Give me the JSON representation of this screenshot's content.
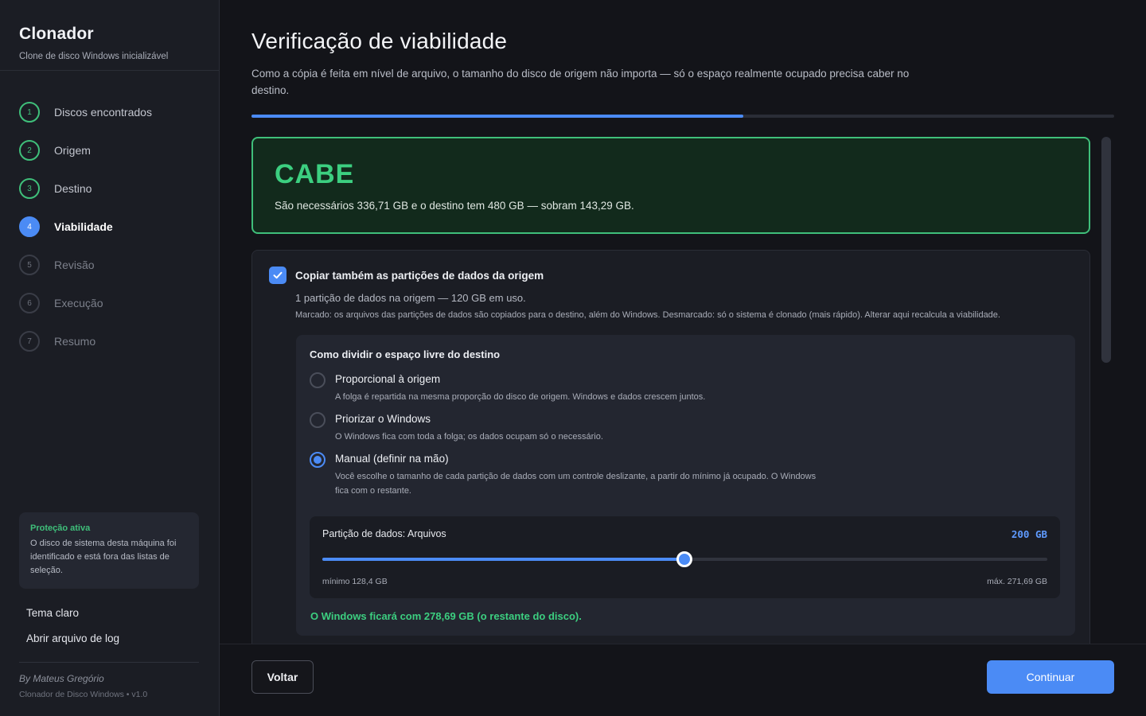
{
  "sidebar": {
    "app_title": "Clonador",
    "app_subtitle": "Clone de disco Windows inicializável",
    "steps": [
      {
        "number": "1",
        "label": "Discos encontrados",
        "state": "done"
      },
      {
        "number": "2",
        "label": "Origem",
        "state": "done"
      },
      {
        "number": "3",
        "label": "Destino",
        "state": "done"
      },
      {
        "number": "4",
        "label": "Viabilidade",
        "state": "active"
      },
      {
        "number": "5",
        "label": "Revisão",
        "state": "todo"
      },
      {
        "number": "6",
        "label": "Execução",
        "state": "todo"
      },
      {
        "number": "7",
        "label": "Resumo",
        "state": "todo"
      }
    ],
    "protection": {
      "title": "Proteção ativa",
      "text": "O disco de sistema desta máquina foi identificado e está fora das listas de seleção."
    },
    "links": {
      "theme": "Tema claro",
      "log": "Abrir arquivo de log"
    },
    "author": "By Mateus Gregório",
    "version": "Clonador de Disco Windows • v1.0"
  },
  "main": {
    "title": "Verificação de viabilidade",
    "description": "Como a cópia é feita em nível de arquivo, o tamanho do disco de origem não importa — só o espaço realmente ocupado precisa caber no destino.",
    "progress_fraction": 0.57,
    "verdict": {
      "title": "CABE",
      "text": "São necessários 336,71 GB e o destino tem 480 GB — sobram 143,29 GB."
    },
    "data_partitions": {
      "checked": true,
      "label": "Copiar também as partições de dados da origem",
      "info": "1 partição de dados na origem — 120 GB em uso.",
      "note": "Marcado: os arquivos das partições de dados são copiados para o destino, além do Windows. Desmarcado: só o sistema é clonado (mais rápido). Alterar aqui recalcula a viabilidade."
    },
    "split": {
      "title": "Como dividir o espaço livre do destino",
      "options": [
        {
          "label": "Proporcional à origem",
          "desc": "A folga é repartida na mesma proporção do disco de origem. Windows e dados crescem juntos.",
          "selected": false
        },
        {
          "label": "Priorizar o Windows",
          "desc": "O Windows fica com toda a folga; os dados ocupam só o necessário.",
          "selected": false
        },
        {
          "label": "Manual (definir na mão)",
          "desc": "Você escolhe o tamanho de cada partição de dados com um controle deslizante, a partir do mínimo já ocupado. O Windows fica com o restante.",
          "selected": true
        }
      ],
      "slider": {
        "label": "Partição de dados:  Arquivos",
        "value_text": "200 GB",
        "min": 128.4,
        "max": 271.69,
        "value": 200,
        "min_label": "mínimo 128,4 GB",
        "max_label": "máx. 271,69 GB"
      },
      "windows_note": "O Windows ficará com 278,69 GB (o restante do disco)."
    }
  },
  "footer": {
    "back_label": "Voltar",
    "next_label": "Continuar"
  },
  "colors": {
    "accent": "#4b8bf5",
    "success": "#3fbf7a",
    "background": "#131419",
    "sidebar": "#1b1d24"
  }
}
